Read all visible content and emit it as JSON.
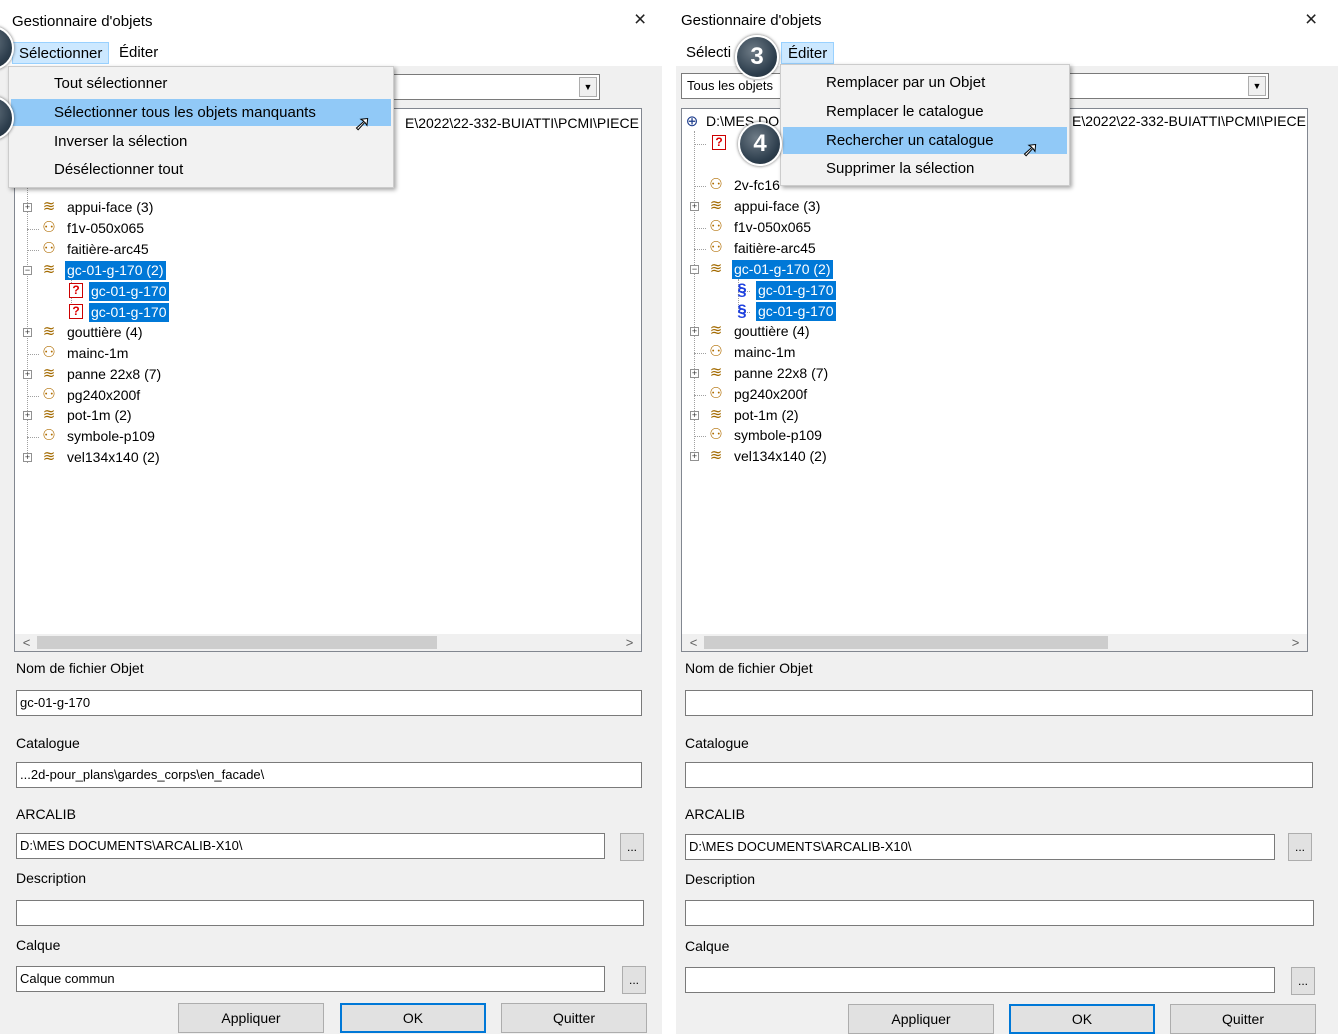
{
  "left": {
    "title": "Gestionnaire d'objets",
    "menu": [
      "Sélectionner",
      "Éditer"
    ],
    "dropdown": [
      "Tout sélectionner",
      "Sélectionner tous les objets manquants",
      "Inverser la sélection",
      "Désélectionner tout"
    ],
    "root_path_tail": "E\\2022\\22-332-BUIATTI\\PCMI\\PIECE",
    "tree": [
      "appui-face (3)",
      "f1v-050x065",
      "faitière-arc45",
      "gc-01-g-170 (2)",
      "gc-01-g-170",
      "gc-01-g-170",
      "gouttière (4)",
      "mainc-1m",
      "panne 22x8 (7)",
      "pg240x200f",
      "pot-1m (2)",
      "symbole-p109",
      "vel134x140 (2)"
    ],
    "fields": {
      "object_file_label": "Nom de fichier Objet",
      "object_file": "gc-01-g-170",
      "catalogue_label": "Catalogue",
      "catalogue": "...2d-pour_plans\\gardes_corps\\en_facade\\",
      "arcalib_label": "ARCALIB",
      "arcalib": "D:\\MES DOCUMENTS\\ARCALIB-X10\\",
      "description_label": "Description",
      "description": "",
      "layer_label": "Calque",
      "layer": "Calque commun"
    },
    "browse": "...",
    "buttons": {
      "apply": "Appliquer",
      "ok": "OK",
      "quit": "Quitter"
    }
  },
  "right": {
    "title": "Gestionnaire d'objets",
    "menu": [
      "Sélecti",
      "Éditer"
    ],
    "combo": "Tous les objets",
    "dropdown": [
      "Remplacer par un Objet",
      "Remplacer le catalogue",
      "Rechercher un catalogue",
      "Supprimer la sélection"
    ],
    "root_path_head": "D:\\MES DO",
    "root_path_tail": "E\\2022\\22-332-BUIATTI\\PCMI\\PIECE",
    "tree_partial": "2v-fc16",
    "tree": [
      "appui-face (3)",
      "f1v-050x065",
      "faitière-arc45",
      "gc-01-g-170 (2)",
      "gc-01-g-170",
      "gc-01-g-170",
      "gouttière (4)",
      "mainc-1m",
      "panne 22x8 (7)",
      "pg240x200f",
      "pot-1m (2)",
      "symbole-p109",
      "vel134x140 (2)"
    ],
    "fields": {
      "object_file_label": "Nom de fichier Objet",
      "object_file": "",
      "catalogue_label": "Catalogue",
      "catalogue": "",
      "arcalib_label": "ARCALIB",
      "arcalib": "D:\\MES DOCUMENTS\\ARCALIB-X10\\",
      "description_label": "Description",
      "description": "",
      "layer_label": "Calque",
      "layer": ""
    },
    "browse": "...",
    "buttons": {
      "apply": "Appliquer",
      "ok": "OK",
      "quit": "Quitter"
    }
  },
  "icons": {
    "close": "×",
    "arrow_down": "▼",
    "arrow_left": "<",
    "arrow_right": ">",
    "expand": "+",
    "collapse": "−",
    "cursor": "➚"
  },
  "steps": [
    "3",
    "4"
  ],
  "colors": {
    "selection": "#0078d7",
    "menu_hover": "#91c9f7",
    "menu_active": "#cce8ff",
    "badge": "#2d3e4d"
  }
}
